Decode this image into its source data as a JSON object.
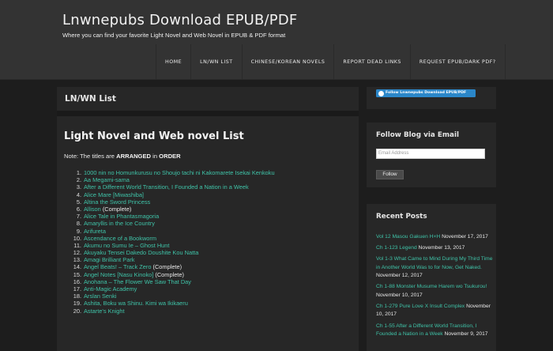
{
  "header": {
    "site_title": "Lnwnepubs Download EPUB/PDF",
    "site_description": "Where you can find your favorite Light Novel and Web Novel in EPUB & PDF format",
    "nav": [
      "HOME",
      "LN/WN LIST",
      "CHINESE/KOREAN NOVELS",
      "REPORT DEAD LINKS",
      "REQUEST EPUB/DARK PDF?"
    ]
  },
  "main": {
    "page_title": "LN/WN List",
    "heading": "Light Novel and Web novel List",
    "note_prefix": "Note: The titles are ",
    "note_arranged": "ARRANGED",
    "note_in": " in ",
    "note_order": "ORDER",
    "novels": [
      {
        "num": "1.",
        "title": "1000 nin no Homunkurusu no Shoujo tachi ni Kakomarete Isekai Kenkoku",
        "extra": ""
      },
      {
        "num": "2.",
        "title": "Aa Megami-sama",
        "extra": ""
      },
      {
        "num": "3.",
        "title": "After a Different World Transition, I Founded a Nation in a Week",
        "extra": ""
      },
      {
        "num": "4.",
        "title": "Alice Mare [Miwashiba]",
        "extra": ""
      },
      {
        "num": "5.",
        "title": "Altina the Sword Princess",
        "extra": ""
      },
      {
        "num": "6.",
        "title": "Allison",
        "extra": " (Complete)"
      },
      {
        "num": "7.",
        "title": "Alice Tale in Phantasmagoria",
        "extra": ""
      },
      {
        "num": "8.",
        "title": "Amaryllis in the Ice Country",
        "extra": ""
      },
      {
        "num": "9.",
        "title": "Arifureta",
        "extra": ""
      },
      {
        "num": "10.",
        "title": "Ascendance of a Bookworm",
        "extra": ""
      },
      {
        "num": "11.",
        "title": "Akumu no Sumu Ie – Ghost Hunt",
        "extra": ""
      },
      {
        "num": "12.",
        "title": "Akuyaku Tensei Dakedo Doushite Kou Natta",
        "extra": ""
      },
      {
        "num": "13.",
        "title": "Amagi Brilliant Park",
        "extra": ""
      },
      {
        "num": "14.",
        "title": "Angel Beats! – Track Zero",
        "extra": "  (Complete)"
      },
      {
        "num": "15.",
        "title": "Angel Notes [Nasu Kinoko]",
        "extra": "  (Complete)"
      },
      {
        "num": "16.",
        "title": "Anohana – The Flower We Saw That Day",
        "extra": ""
      },
      {
        "num": "17.",
        "title": "Anti-Magic Academy",
        "extra": ""
      },
      {
        "num": "18.",
        "title": "Arslan Senki",
        "extra": ""
      },
      {
        "num": "19.",
        "title": "Ashita, Boku wa Shinu. Kimi wa Ikikaeru",
        "extra": ""
      },
      {
        "num": "20.",
        "title": "Astarte's Knight",
        "extra": ""
      }
    ]
  },
  "sidebar": {
    "follow_badge": "Follow Lnwnepubs Download EPUB/PDF",
    "email_widget": {
      "title": "Follow Blog via Email",
      "placeholder": "Email Address",
      "button": "Follow"
    },
    "recent_posts": {
      "title": "Recent Posts",
      "items": [
        {
          "title": "Vol 12 Masou Gakuen H×H",
          "date": "November 17, 2017"
        },
        {
          "title": "Ch 1-123 Legend",
          "date": "November 13, 2017"
        },
        {
          "title": "Vol 1-3 What Came to Mind During My Third Time in Another World Was to for Now, Get Naked.",
          "date": "November 12, 2017"
        },
        {
          "title": "Ch 1-88 Monster Musume Harem wo Tsukurou!",
          "date": "November 10, 2017"
        },
        {
          "title": "Ch 1-279 Pure Love X Insult Complex",
          "date": "November 10, 2017"
        },
        {
          "title": "Ch 1-55 After a Different World Transition, I Founded a Nation in a Week",
          "date": "November 9, 2017"
        }
      ]
    }
  }
}
